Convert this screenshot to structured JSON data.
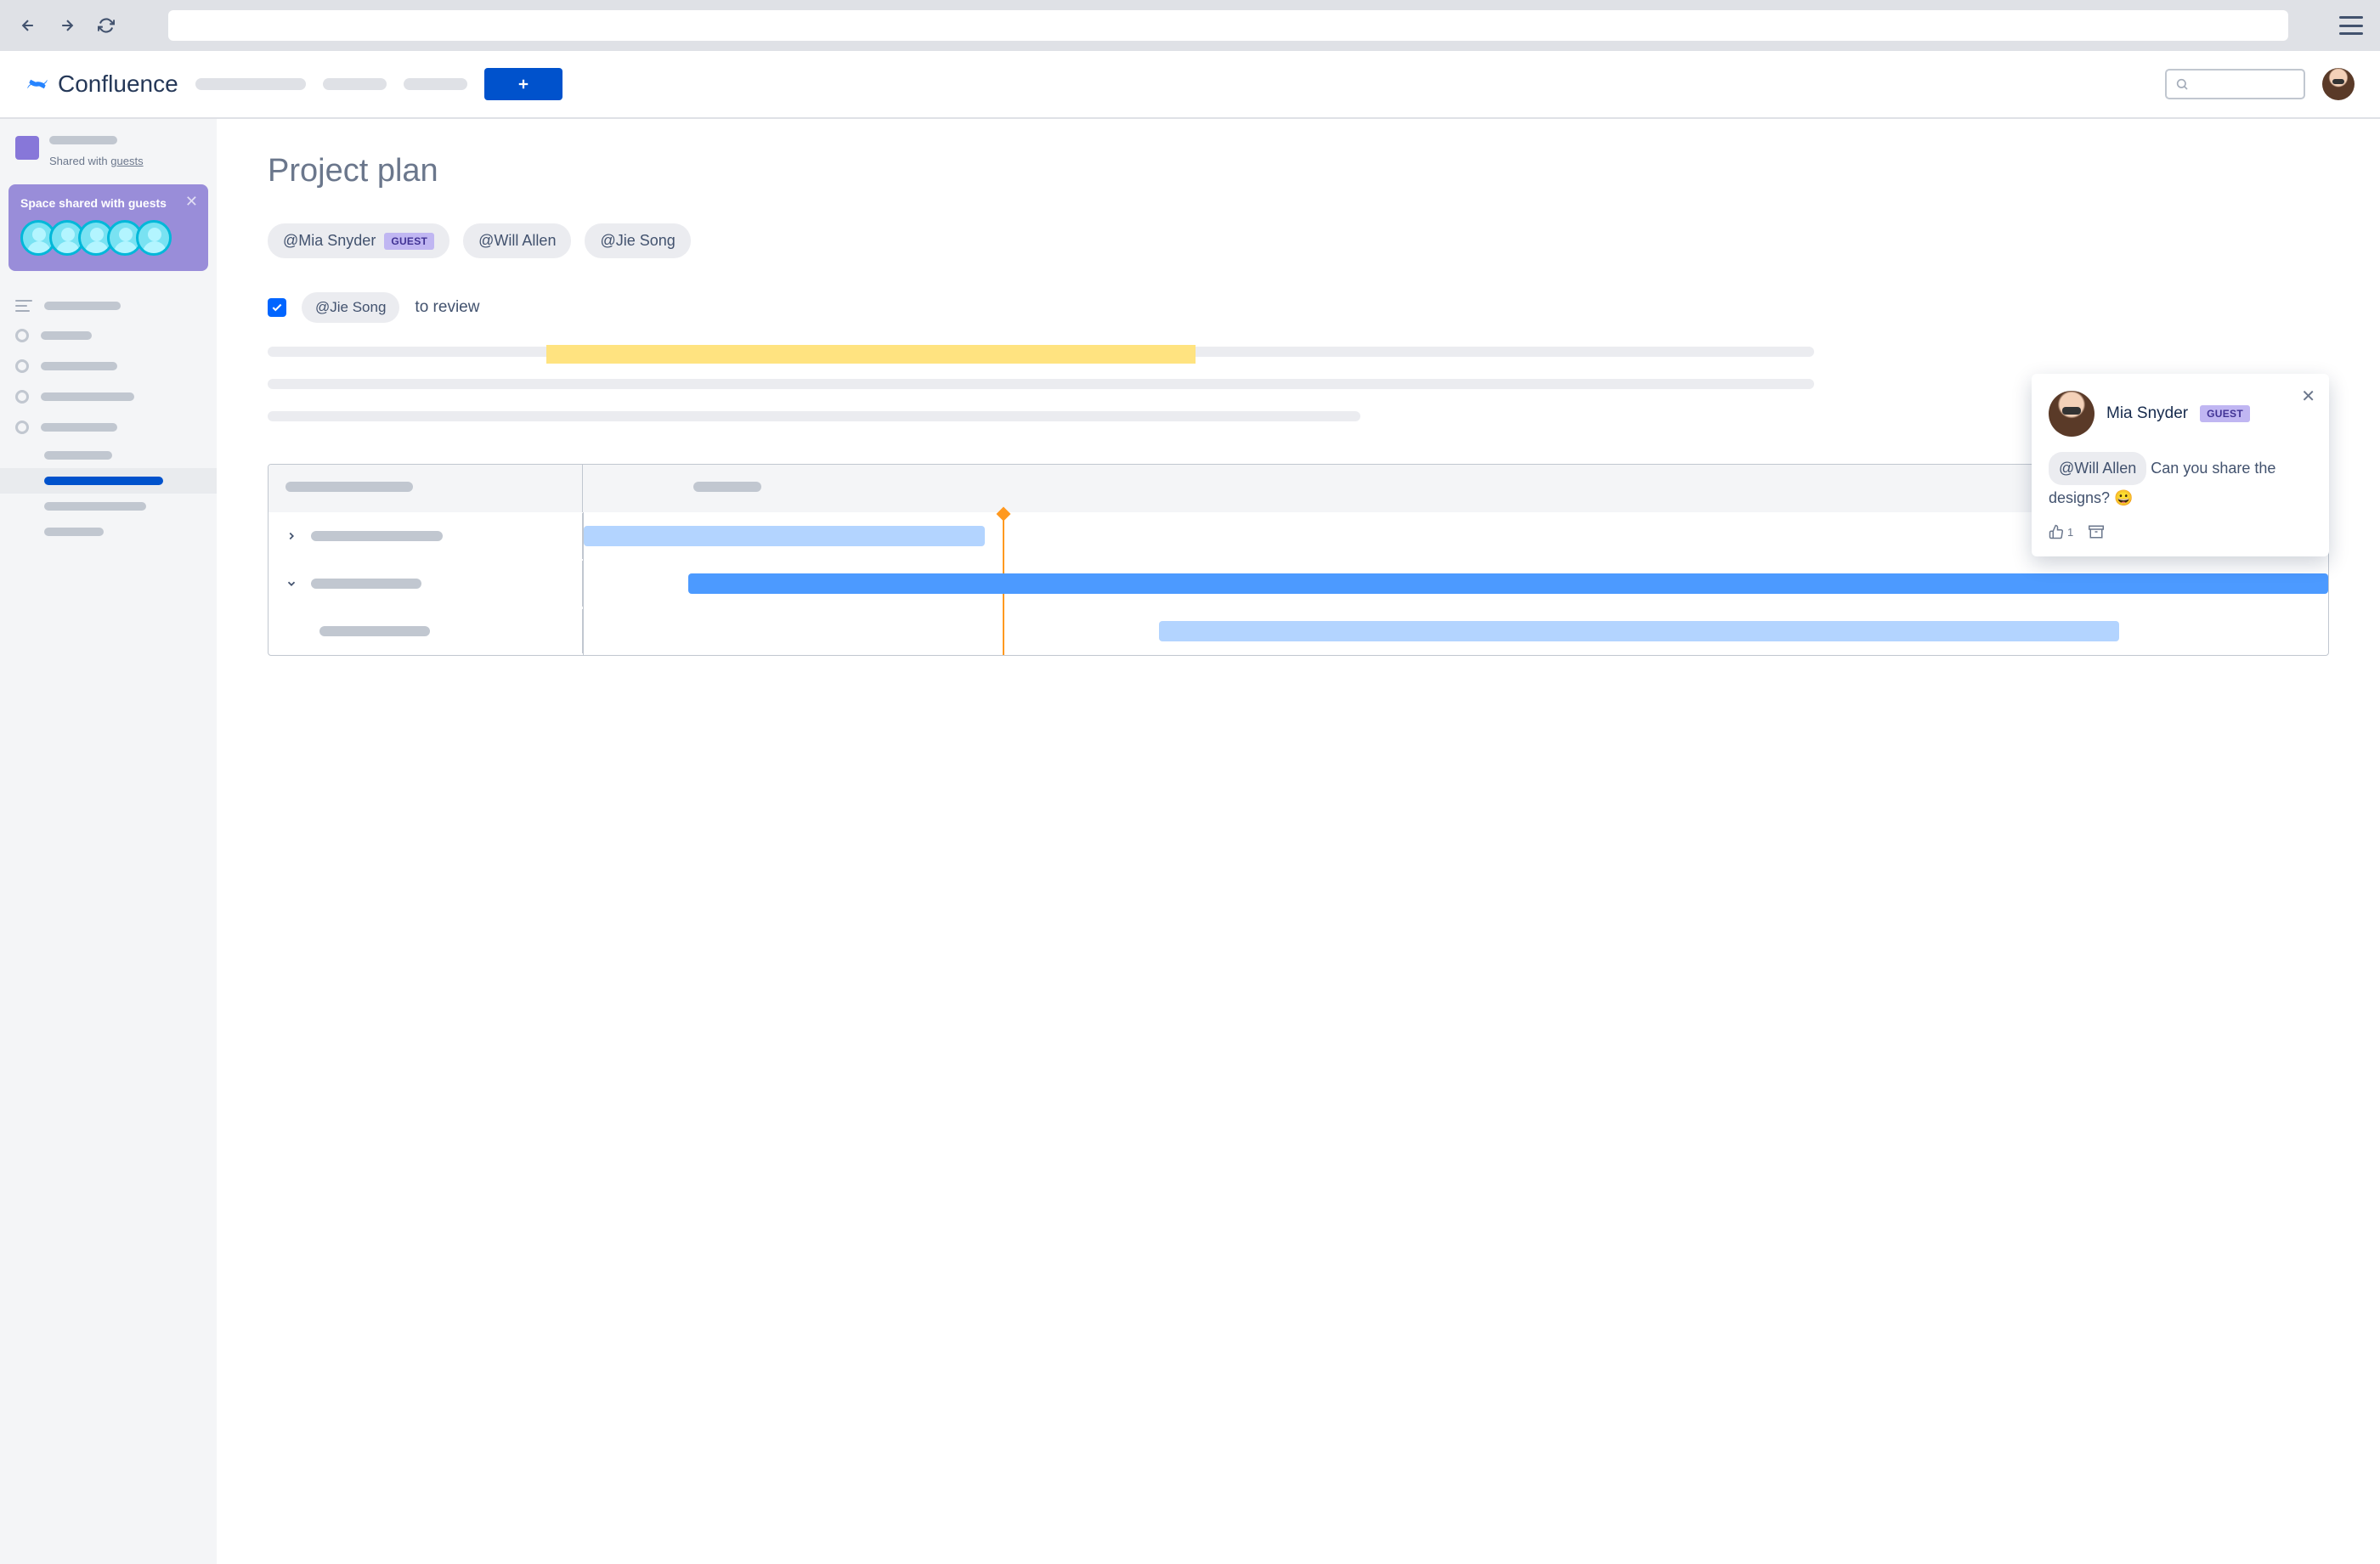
{
  "app": {
    "name": "Confluence"
  },
  "sidebar": {
    "shared_prefix": "Shared with ",
    "shared_link": "guests",
    "guest_panel": {
      "title": "Space shared with guests",
      "avatar_count": 5
    }
  },
  "page": {
    "title": "Project plan",
    "mentions": [
      {
        "name": "@Mia Snyder",
        "guest": true
      },
      {
        "name": "@Will Allen",
        "guest": false
      },
      {
        "name": "@Jie Song",
        "guest": false
      }
    ],
    "guest_badge": "GUEST",
    "task": {
      "mention": "@Jie Song",
      "text": "to review",
      "checked": true
    }
  },
  "comment": {
    "author": "Mia Snyder",
    "author_guest": true,
    "mention": "@Will Allen",
    "text_after": " Can you share the designs? 😀",
    "likes": "1"
  }
}
